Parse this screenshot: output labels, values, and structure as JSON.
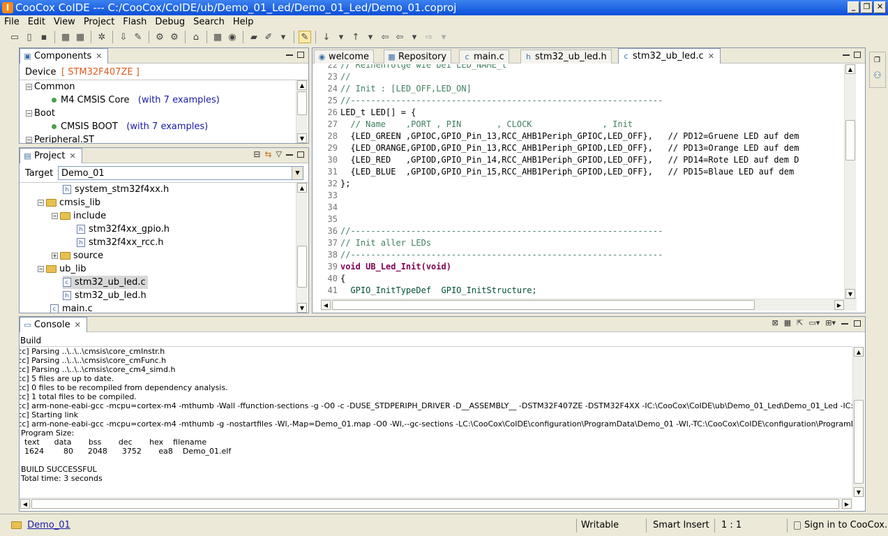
{
  "window": {
    "title": "CooCox CoIDE --- C:/CooCox/CoIDE/ub/Demo_01_Led/Demo_01_Led/Demo_01.coproj"
  },
  "menu": [
    "File",
    "Edit",
    "View",
    "Project",
    "Flash",
    "Debug",
    "Search",
    "Help"
  ],
  "components": {
    "tab": "Components",
    "device_label": "Device",
    "device_value": "[ STM32F407ZE ]",
    "items": [
      {
        "label": "Common",
        "type": "group"
      },
      {
        "label": "M4 CMSIS Core",
        "link": "(with 7 examples)",
        "type": "item"
      },
      {
        "label": "Boot",
        "type": "group"
      },
      {
        "label": "CMSIS BOOT",
        "link": "(with 7 examples)",
        "type": "item"
      },
      {
        "label": "Peripheral.ST",
        "type": "group"
      }
    ]
  },
  "project": {
    "tab": "Project",
    "target_label": "Target",
    "target_value": "Demo_01",
    "tree": [
      "system_stm32f4xx.h",
      "cmsis_lib",
      "include",
      "stm32f4xx_gpio.h",
      "stm32f4xx_rcc.h",
      "source",
      "ub_lib",
      "stm32_ub_led.c",
      "stm32_ub_led.h",
      "main.c"
    ]
  },
  "editor": {
    "tabs": [
      "welcome",
      "Repository",
      "main.c",
      "stm32_ub_led.h",
      "stm32_ub_led.c"
    ],
    "lines": [
      {
        "n": "22",
        "t": "// Reihenfolge wie bei LED_NAME_t"
      },
      {
        "n": "23",
        "t": "//"
      },
      {
        "n": "24",
        "t": "// Init : [LED_OFF,LED_ON]"
      },
      {
        "n": "25",
        "t": "//--------------------------------------------------------------"
      },
      {
        "n": "26",
        "t": "LED_t LED[] = {"
      },
      {
        "n": "27",
        "t": "  // Name    ,PORT , PIN       , CLOCK              , Init"
      },
      {
        "n": "28",
        "t": "  {LED_GREEN ,GPIOC,GPIO_Pin_13,RCC_AHB1Periph_GPIOC,LED_OFF},   // PD12=Gruene LED auf dem"
      },
      {
        "n": "29",
        "t": "  {LED_ORANGE,GPIOD,GPIO_Pin_13,RCC_AHB1Periph_GPIOD,LED_OFF},   // PD13=Orange LED auf dem"
      },
      {
        "n": "30",
        "t": "  {LED_RED   ,GPIOD,GPIO_Pin_14,RCC_AHB1Periph_GPIOD,LED_OFF},   // PD14=Rote LED auf dem D"
      },
      {
        "n": "31",
        "t": "  {LED_BLUE  ,GPIOD,GPIO_Pin_15,RCC_AHB1Periph_GPIOD,LED_OFF},   // PD15=Blaue LED auf dem"
      },
      {
        "n": "32",
        "t": "};"
      },
      {
        "n": "33",
        "t": ""
      },
      {
        "n": "34",
        "t": ""
      },
      {
        "n": "35",
        "t": ""
      },
      {
        "n": "36",
        "t": "//--------------------------------------------------------------"
      },
      {
        "n": "37",
        "t": "// Init aller LEDs"
      },
      {
        "n": "38",
        "t": "//--------------------------------------------------------------"
      },
      {
        "n": "39",
        "t": "void UB_Led_Init(void)"
      },
      {
        "n": "40",
        "t": "{"
      },
      {
        "n": "41",
        "t": "  GPIO_InitTypeDef  GPIO_InitStructure;"
      }
    ]
  },
  "console": {
    "tab": "Console",
    "header": "Build",
    "lines": [
      "      [cc] Parsing ..\\..\\..\\cmsis\\core_cmInstr.h",
      "      [cc] Parsing ..\\..\\..\\cmsis\\core_cmFunc.h",
      "      [cc] Parsing ..\\..\\..\\cmsis\\core_cm4_simd.h",
      "      [cc] 5 files are up to date.",
      "      [cc] 0 files to be recompiled from dependency analysis.",
      "      [cc] 1 total files to be compiled.",
      "      [cc] arm-none-eabi-gcc -mcpu=cortex-m4 -mthumb -Wall -ffunction-sections -g -O0 -c -DUSE_STDPERIPH_DRIVER -D__ASSEMBLY__ -DSTM32F407ZE -DSTM32F4XX -IC:\\CooCox\\CoIDE\\ub\\Demo_01_Led\\Demo_01_Led -IC:\\CooCox\\CoIDE\\ub\\De",
      "      [cc] Starting link",
      "      [cc] arm-none-eabi-gcc -mcpu=cortex-m4 -mthumb -g -nostartfiles -Wl,-Map=Demo_01.map -O0 -Wl,--gc-sections -LC:\\CooCox\\CoIDE\\configuration\\ProgramData\\Demo_01 -Wl,-TC:\\CooCox\\CoIDE\\configuration\\ProgramData\\Demo_01/arm-gcc",
      "Program Size:",
      "      text      data       bss       dec       hex    filename",
      "      1624        80      2048      3752       ea8    Demo_01.elf",
      "",
      "BUILD SUCCESSFUL",
      "Total time: 3 seconds"
    ]
  },
  "status": {
    "project": "Demo_01",
    "writable": "Writable",
    "insert": "Smart Insert",
    "position": "1 : 1",
    "signin": "Sign in to CooCox..."
  }
}
